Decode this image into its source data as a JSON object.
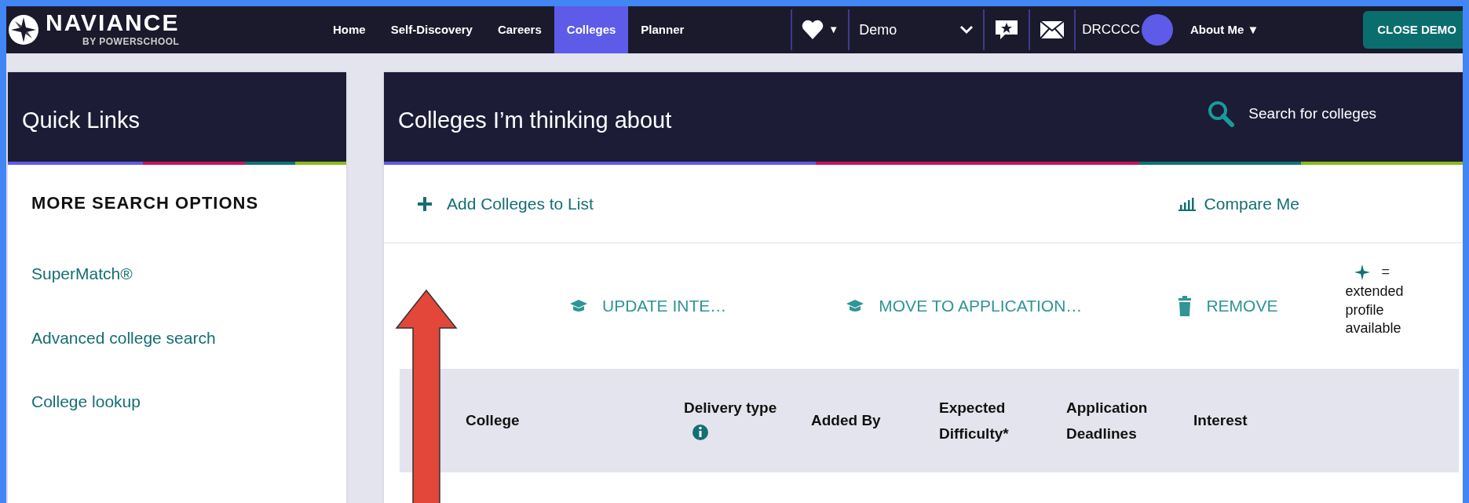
{
  "navbar": {
    "logo": {
      "name": "NAVIANCE",
      "tagline": "BY POWERSCHOOL"
    },
    "items": [
      {
        "label": "Home",
        "selected": false
      },
      {
        "label": "Self-Discovery",
        "selected": false
      },
      {
        "label": "Careers",
        "selected": false
      },
      {
        "label": "Colleges",
        "selected": true
      },
      {
        "label": "Planner",
        "selected": false
      }
    ],
    "favorites_caret": "▼",
    "account": {
      "value": "Demo"
    },
    "avatar": "DRCCCC",
    "about": "About Me ▼",
    "close_button": "CLOSE DEMO"
  },
  "quick_links": {
    "title": "Quick Links",
    "section": "MORE SEARCH OPTIONS",
    "links": [
      "SuperMatch®",
      "Advanced college search",
      "College lookup"
    ]
  },
  "main": {
    "title": "Colleges I’m thinking about",
    "search": "Search for colleges",
    "add_link": "Add Colleges to List",
    "compare_link": "Compare Me",
    "actions": [
      {
        "kind": "cap",
        "label": "UPDATE INTE…"
      },
      {
        "kind": "cap",
        "label": "MOVE TO APPLICATION…"
      },
      {
        "kind": "trash",
        "label": "REMOVE"
      }
    ],
    "legend_sign": "=",
    "legend": "extended profile available",
    "columns": [
      {
        "label": "College",
        "info_icon": false
      },
      {
        "label": "Delivery type",
        "info_icon": true
      },
      {
        "label": "Added By",
        "info_icon": false
      },
      {
        "label": "Expected Difficulty*",
        "info_icon": false
      },
      {
        "label": "Application Deadlines",
        "info_icon": false
      },
      {
        "label": "Interest",
        "info_icon": false
      }
    ]
  },
  "annotation": {
    "kind": "arrow"
  }
}
